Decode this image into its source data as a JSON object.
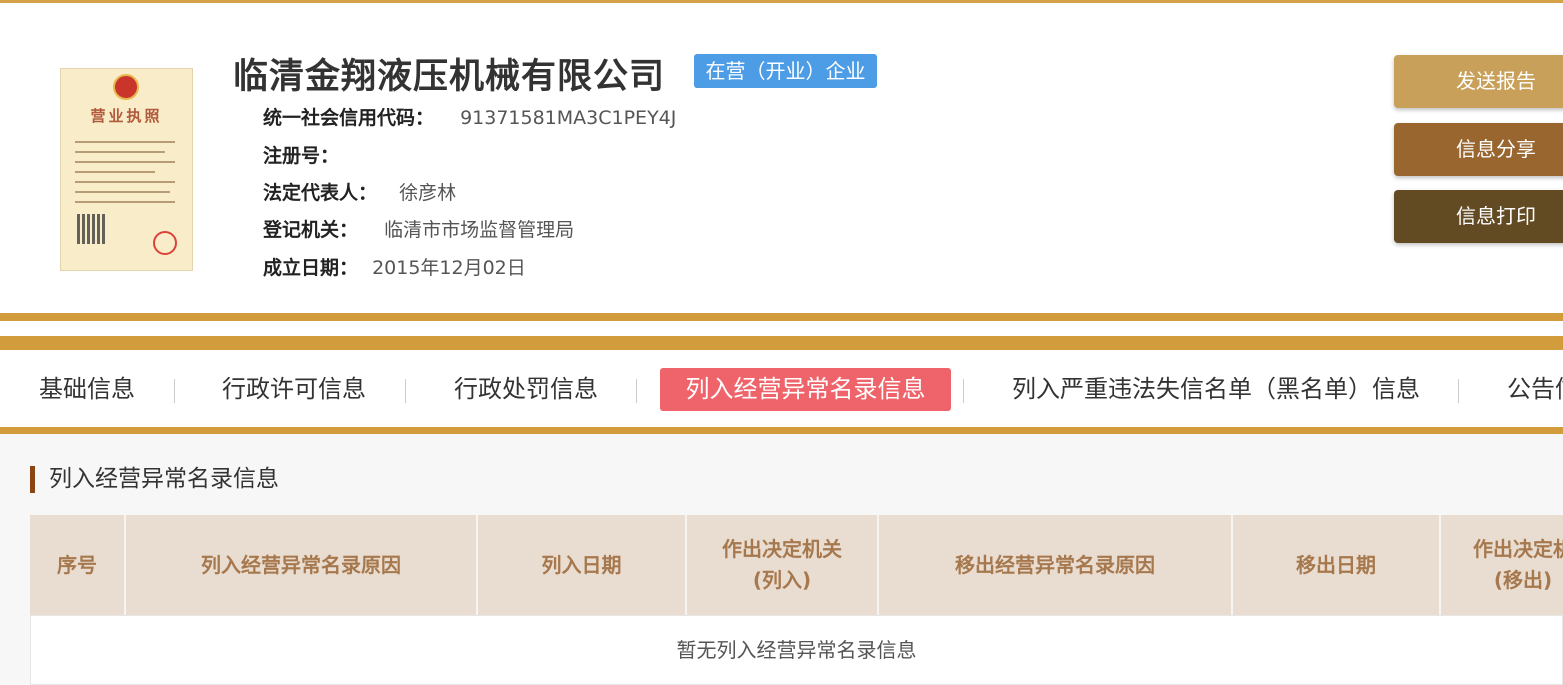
{
  "company": {
    "name": "临清金翔液压机械有限公司",
    "status": "在营（开业）企业",
    "license_image_title": "营业执照"
  },
  "info": [
    {
      "label": "统一社会信用代码：",
      "value": "91371581MA3C1PEY4J"
    },
    {
      "label": "注册号：",
      "value": ""
    },
    {
      "label": "法定代表人：",
      "value": "徐彦林"
    },
    {
      "label": "登记机关：",
      "value": "临清市市场监督管理局"
    },
    {
      "label": "成立日期：",
      "value": "2015年12月02日"
    }
  ],
  "actions": {
    "send_report": "发送报告",
    "share": "信息分享",
    "print": "信息打印"
  },
  "tabs": [
    {
      "label": "基础信息"
    },
    {
      "label": "行政许可信息"
    },
    {
      "label": "行政处罚信息"
    },
    {
      "label": "列入经营异常名录信息",
      "active": true
    },
    {
      "label": "列入严重违法失信名单（黑名单）信息"
    },
    {
      "label": "公告信"
    }
  ],
  "section": {
    "title": "列入经营异常名录信息",
    "columns": [
      "序号",
      "列入经营异常名录原因",
      "列入日期",
      "作出决定机关\n(列入)",
      "移出经营异常名录原因",
      "移出日期",
      "作出决定机\n(移出)"
    ],
    "empty_text": "暂无列入经营异常名录信息"
  },
  "colors": {
    "accent": "#d29c3d",
    "active_tab": "#ef646a",
    "status_badge": "#4c9ce6",
    "btn_send": "#c8a05a",
    "btn_share": "#98662e",
    "btn_print": "#624a22"
  }
}
